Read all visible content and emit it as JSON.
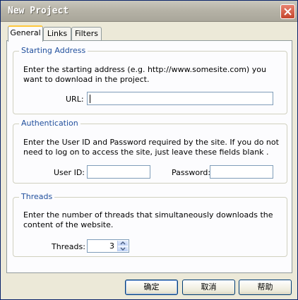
{
  "window": {
    "title": "New Project"
  },
  "tabs": [
    {
      "label": "General",
      "active": true
    },
    {
      "label": "Links",
      "active": false
    },
    {
      "label": "Filters",
      "active": false
    }
  ],
  "starting_address": {
    "legend": "Starting Address",
    "description": "Enter the starting address (e.g. http://www.somesite.com) you want to download in the project.",
    "url_label": "URL:",
    "url_value": ""
  },
  "authentication": {
    "legend": "Authentication",
    "description": "Enter the User ID and Password required by the site.  If you do not need to log on to access the site, just leave these fields blank .",
    "user_id_label": "User ID:",
    "user_id_value": "",
    "password_label": "Password:",
    "password_value": ""
  },
  "threads": {
    "legend": "Threads",
    "description": "Enter the number of threads that simultaneously downloads the content of the website.",
    "threads_label": "Threads:",
    "threads_value": "3"
  },
  "buttons": {
    "ok": "确定",
    "cancel": "取消",
    "help": "帮助"
  },
  "colors": {
    "legend_text": "#1f4e9c",
    "close_button": "#c4452c",
    "field_border": "#7f9db9"
  }
}
